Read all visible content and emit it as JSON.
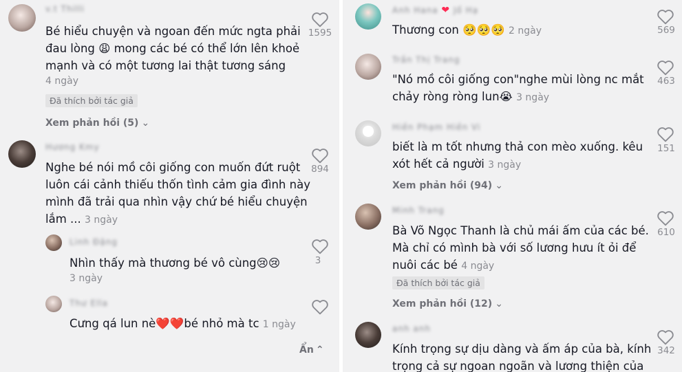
{
  "left_column": {
    "comments": [
      {
        "username": "v.t Thilli",
        "text_lines": [
          "Bé hiểu chuyện và ngoan đến mức ngta phải",
          "đau lòng 😩 mong các bé có thể lớn lên khoẻ",
          "mạnh và có một tương lai thật tương sáng"
        ],
        "date": "4 ngày",
        "liked_by_author": "Đã thích bởi tác giả",
        "view_replies": "Xem phản hồi (5)",
        "likes": "1595"
      },
      {
        "username": "Hương Kmy",
        "text_lines": [
          "Nghe bé nói mồ côi giống con muốn đứt ruột",
          "luôn cái cảnh thiếu thốn tình cảm gia đình này",
          "mình đã trải qua nhìn vậy chứ bé hiểu chuyện",
          "lắm ..."
        ],
        "date": "3 ngày",
        "likes": "894"
      }
    ],
    "replies": [
      {
        "username": "Linh Đặng",
        "text": "Nhìn thấy mà thương bé vô cùng😢😢",
        "date": "3 ngày",
        "likes": "3"
      },
      {
        "username": "Thư Ella",
        "text": "Cưng qá lun nè❤️❤️bé nhỏ mà tc",
        "date": "1 ngày",
        "likes": ""
      }
    ],
    "collapse": "Ẩn"
  },
  "right_column": {
    "comments": [
      {
        "username": "Anh Hana",
        "username_suffix": "Jố Hạ",
        "text": "Thương con 🥺🥺🥺",
        "date": "2 ngày",
        "likes": "569"
      },
      {
        "username": "Trần Thị Trang",
        "text_lines": [
          "\"Nó mồ côi giống con\"nghe mùi lòng nc mắt",
          "chảy ròng ròng lun😭"
        ],
        "date": "3 ngày",
        "likes": "463"
      },
      {
        "username": "Hiền Phạm Hiền Vi",
        "text_lines": [
          "biết là m tốt nhưng thả con mèo xuống. kêu",
          "xót hết cả người"
        ],
        "date": "3 ngày",
        "view_replies": "Xem phản hồi (94)",
        "likes": "151"
      },
      {
        "username": "Minh Trang",
        "text_lines": [
          "Bà Võ Ngọc Thanh là chủ mái ấm của các bé.",
          "Mà chỉ có mình bà với số lương hưu ít ỏi để",
          "nuôi các bé"
        ],
        "date": "4 ngày",
        "liked_by_author": "Đã thích bởi tác giả",
        "view_replies": "Xem phản hồi (12)",
        "likes": "610"
      },
      {
        "username": "anh anh",
        "text_lines": [
          "Kính trọng sự dịu dàng và ấm áp của bà, kính",
          "trọng cả sự ngoan ngoãn và lương thiện của"
        ],
        "likes": "342"
      }
    ]
  },
  "colors": {
    "background": "#f1f1f2",
    "text": "#161823",
    "secondary_text": "#8a8b91",
    "accent": "#fe2c55"
  },
  "icons": {
    "like": "heart-outline-icon",
    "chevron": "chevron-down-icon",
    "collapse": "chevron-up-icon"
  }
}
